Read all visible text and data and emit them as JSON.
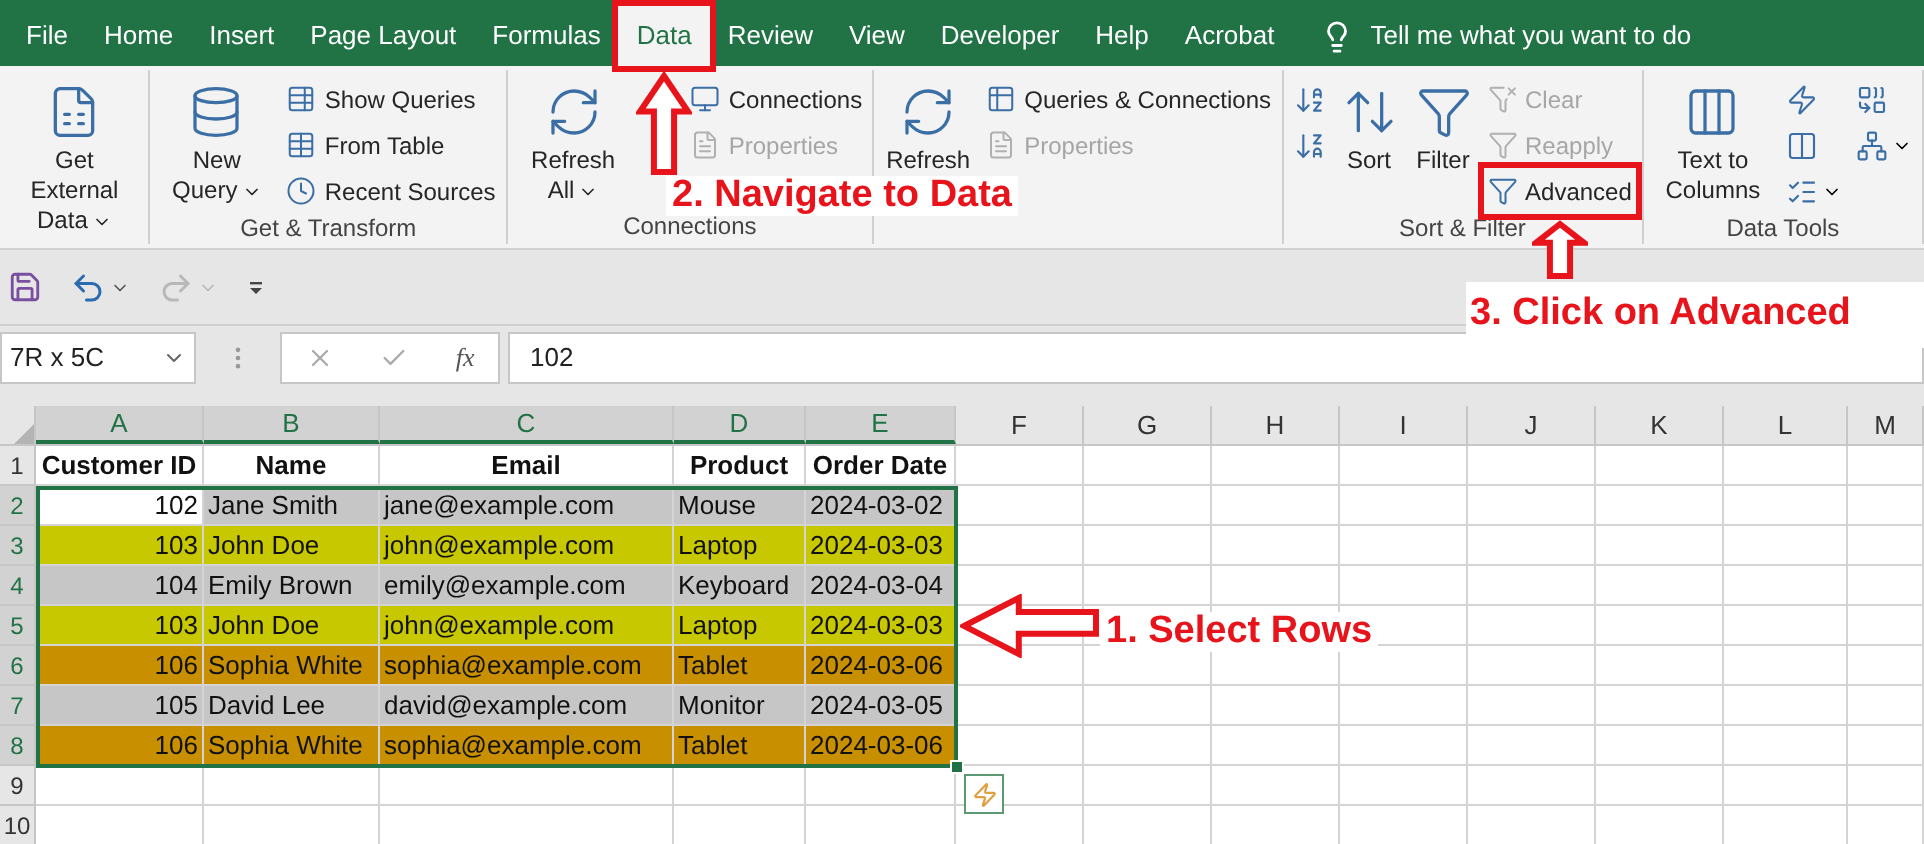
{
  "ribbon_tabs": [
    {
      "label": "File",
      "selected": false,
      "highlighted": false
    },
    {
      "label": "Home",
      "selected": false,
      "highlighted": false
    },
    {
      "label": "Insert",
      "selected": false,
      "highlighted": false
    },
    {
      "label": "Page Layout",
      "selected": false,
      "highlighted": false
    },
    {
      "label": "Formulas",
      "selected": false,
      "highlighted": false
    },
    {
      "label": "Data",
      "selected": true,
      "highlighted": true
    },
    {
      "label": "Review",
      "selected": false,
      "highlighted": false
    },
    {
      "label": "View",
      "selected": false,
      "highlighted": false
    },
    {
      "label": "Developer",
      "selected": false,
      "highlighted": false
    },
    {
      "label": "Help",
      "selected": false,
      "highlighted": false
    },
    {
      "label": "Acrobat",
      "selected": false,
      "highlighted": false
    }
  ],
  "tell_me": "Tell me what you want to do",
  "ribbon": {
    "groups": [
      {
        "buttons": [
          {
            "kind": "large",
            "label": "Get External Data",
            "dropdown": true,
            "disabled": false
          }
        ]
      },
      {
        "label": "Get & Transform",
        "buttons": [
          {
            "kind": "large",
            "label": "New Query",
            "dropdown": true,
            "disabled": false
          },
          {
            "kind": "small",
            "label": "Show Queries",
            "disabled": false
          },
          {
            "kind": "small",
            "label": "From Table",
            "disabled": false
          },
          {
            "kind": "small",
            "label": "Recent Sources",
            "disabled": false
          }
        ]
      },
      {
        "label": "Connections",
        "buttons": [
          {
            "kind": "large",
            "label": "Refresh All",
            "dropdown": true,
            "disabled": false
          },
          {
            "kind": "small",
            "label": "Connections",
            "disabled": false
          },
          {
            "kind": "small",
            "label": "Properties",
            "disabled": true
          }
        ]
      },
      {
        "buttons": [
          {
            "kind": "large",
            "label": "Refresh",
            "disabled": false
          },
          {
            "kind": "small",
            "label": "Queries & Connections",
            "disabled": false
          },
          {
            "kind": "small",
            "label": "Properties",
            "disabled": true
          }
        ]
      },
      {
        "label": "Sort & Filter",
        "buttons": [
          {
            "kind": "icon",
            "disabled": false
          },
          {
            "kind": "icon",
            "disabled": false
          },
          {
            "kind": "large",
            "label": "Sort",
            "disabled": false
          },
          {
            "kind": "large",
            "label": "Filter",
            "disabled": false
          },
          {
            "kind": "small",
            "label": "Clear",
            "disabled": true
          },
          {
            "kind": "small",
            "label": "Reapply",
            "disabled": true
          },
          {
            "kind": "small",
            "label": "Advanced",
            "disabled": false,
            "highlighted": true
          }
        ]
      },
      {
        "label": "Data Tools",
        "buttons": [
          {
            "kind": "large",
            "label": "Text to Columns",
            "disabled": false
          },
          {
            "kind": "icon",
            "disabled": false
          },
          {
            "kind": "icon",
            "disabled": false
          },
          {
            "kind": "icon",
            "dropdown": true,
            "disabled": false
          },
          {
            "kind": "icon",
            "disabled": false
          },
          {
            "kind": "icon",
            "dropdown": true,
            "disabled": false
          }
        ]
      }
    ]
  },
  "quick_access": [
    {
      "kind": "save",
      "disabled": false
    },
    {
      "kind": "undo",
      "disabled": false
    },
    {
      "kind": "redo",
      "disabled": true
    },
    {
      "kind": "customize",
      "disabled": false
    }
  ],
  "name_box": "7R x 5C",
  "fx_label": "fx",
  "formula": "102",
  "sheet": {
    "columns": [
      {
        "label": "A",
        "selected": true
      },
      {
        "label": "B",
        "selected": true
      },
      {
        "label": "C",
        "selected": true
      },
      {
        "label": "D",
        "selected": true
      },
      {
        "label": "E",
        "selected": true
      },
      {
        "label": "F",
        "selected": false
      },
      {
        "label": "G",
        "selected": false
      },
      {
        "label": "H",
        "selected": false
      },
      {
        "label": "I",
        "selected": false
      },
      {
        "label": "J",
        "selected": false
      },
      {
        "label": "K",
        "selected": false
      },
      {
        "label": "L",
        "selected": false
      },
      {
        "label": "M",
        "selected": false
      }
    ],
    "rows": [
      {
        "number": "1",
        "kind": "header",
        "selected": false,
        "cells": [
          "Customer ID",
          "Name",
          "Email",
          "Product",
          "Order Date"
        ]
      },
      {
        "number": "2",
        "kind": "data",
        "selected": true,
        "active": true,
        "color": "#c6c6c6",
        "cells": [
          "102",
          "Jane Smith",
          "jane@example.com",
          "Mouse",
          "2024-03-02"
        ]
      },
      {
        "number": "3",
        "kind": "data",
        "selected": true,
        "active": false,
        "color": "#c8c800",
        "cells": [
          "103",
          "John Doe",
          "john@example.com",
          "Laptop",
          "2024-03-03"
        ]
      },
      {
        "number": "4",
        "kind": "data",
        "selected": true,
        "active": false,
        "color": "#c6c6c6",
        "cells": [
          "104",
          "Emily Brown",
          "emily@example.com",
          "Keyboard",
          "2024-03-04"
        ]
      },
      {
        "number": "5",
        "kind": "data",
        "selected": true,
        "active": false,
        "color": "#c8c800",
        "cells": [
          "103",
          "John Doe",
          "john@example.com",
          "Laptop",
          "2024-03-03"
        ]
      },
      {
        "number": "6",
        "kind": "data",
        "selected": true,
        "active": false,
        "color": "#c89000",
        "cells": [
          "106",
          "Sophia White",
          "sophia@example.com",
          "Tablet",
          "2024-03-06"
        ]
      },
      {
        "number": "7",
        "kind": "data",
        "selected": true,
        "active": false,
        "color": "#c6c6c6",
        "cells": [
          "105",
          "David Lee",
          "david@example.com",
          "Monitor",
          "2024-03-05"
        ]
      },
      {
        "number": "8",
        "kind": "data",
        "selected": true,
        "active": false,
        "color": "#c89000",
        "cells": [
          "106",
          "Sophia White",
          "sophia@example.com",
          "Tablet",
          "2024-03-06"
        ]
      },
      {
        "number": "9",
        "kind": "empty",
        "selected": false
      },
      {
        "number": "10",
        "kind": "empty",
        "selected": false
      }
    ]
  },
  "annotations": [
    {
      "text": "2. Navigate to Data"
    },
    {
      "text": "3. Click on Advanced"
    },
    {
      "text": "1. Select Rows"
    }
  ]
}
